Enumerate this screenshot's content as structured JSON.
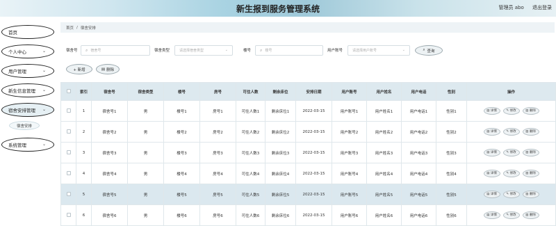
{
  "header": {
    "title": "新生报到服务管理系统",
    "user_label": "管理员 abo",
    "logout": "退出登录"
  },
  "sidebar": {
    "items": [
      {
        "label": "首页",
        "chevron": ""
      },
      {
        "label": "个人中心",
        "chevron": "⌄"
      },
      {
        "label": "用户管理",
        "chevron": "⌄"
      },
      {
        "label": "新生信息管理",
        "chevron": "⌄"
      },
      {
        "label": "宿舍安排管理",
        "chevron": "⌄"
      },
      {
        "label": "系统管理",
        "chevron": "⌄"
      }
    ],
    "submenu": "宿舍安排"
  },
  "breadcrumb": {
    "home": "首页",
    "sep": "/",
    "current": "宿舍安排"
  },
  "search": {
    "dorm_no_label": "宿舍号",
    "dorm_no_placeholder": "宿舍号",
    "dorm_type_label": "宿舍类型",
    "dorm_type_placeholder": "请选择宿舍类型",
    "building_label": "楼号",
    "building_placeholder": "楼号",
    "account_label": "用户账号",
    "account_placeholder": "请选择用户账号",
    "query_button": "查询"
  },
  "actions": {
    "add": "+ 新增",
    "delete": "删除"
  },
  "table": {
    "headers": [
      "",
      "索引",
      "宿舍号",
      "宿舍类型",
      "楼号",
      "房号",
      "可住人数",
      "剩余床位",
      "安排日期",
      "用户账号",
      "用户姓名",
      "用户电话",
      "性别",
      "操作"
    ],
    "rows": [
      [
        "1",
        "宿舍号1",
        "男",
        "楼号1",
        "房号1",
        "可住人数1",
        "剩余床位1",
        "2022-03-15",
        "用户账号1",
        "用户姓名1",
        "用户电话1",
        "性别1"
      ],
      [
        "2",
        "宿舍号2",
        "男",
        "楼号2",
        "房号2",
        "可住人数2",
        "剩余床位2",
        "2022-03-15",
        "用户账号2",
        "用户姓名2",
        "用户电话2",
        "性别2"
      ],
      [
        "3",
        "宿舍号3",
        "男",
        "楼号3",
        "房号3",
        "可住人数3",
        "剩余床位3",
        "2022-03-15",
        "用户账号3",
        "用户姓名3",
        "用户电话3",
        "性别3"
      ],
      [
        "4",
        "宿舍号4",
        "男",
        "楼号4",
        "房号4",
        "可住人数4",
        "剩余床位4",
        "2022-03-15",
        "用户账号4",
        "用户姓名4",
        "用户电话4",
        "性别4"
      ],
      [
        "5",
        "宿舍号5",
        "男",
        "楼号5",
        "房号5",
        "可住人数5",
        "剩余床位5",
        "2022-03-15",
        "用户账号5",
        "用户姓名5",
        "用户电话5",
        "性别5"
      ],
      [
        "6",
        "宿舍号6",
        "男",
        "楼号6",
        "房号6",
        "可住人数6",
        "剩余床位6",
        "2022-03-15",
        "用户账号6",
        "用户姓名6",
        "用户电话6",
        "性别6"
      ]
    ],
    "op_labels": {
      "detail": "详情",
      "edit": "修改",
      "delete": "删除"
    }
  }
}
